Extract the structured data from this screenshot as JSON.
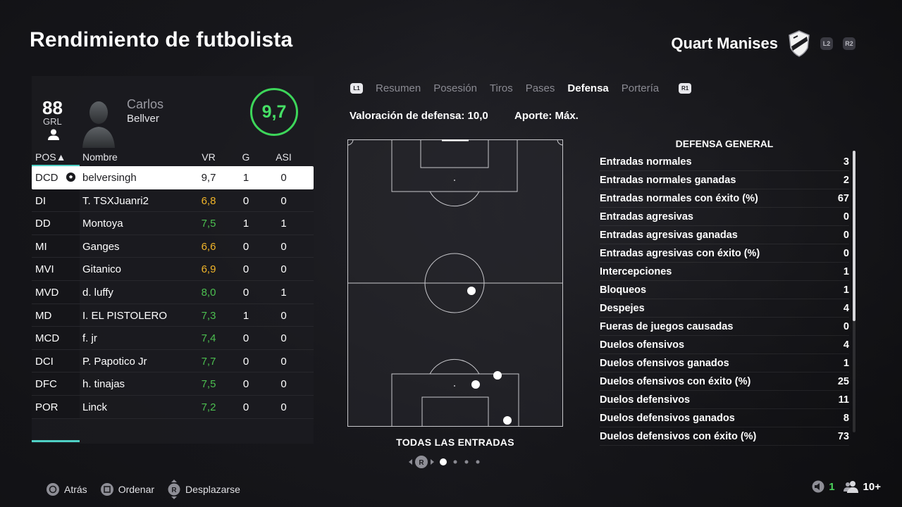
{
  "header": {
    "title": "Rendimiento de futbolista",
    "club_name": "Quart Manises",
    "l2_label": "L2",
    "r2_label": "R2"
  },
  "player": {
    "overall": "88",
    "overall_label": "GRL",
    "first_name": "Carlos",
    "last_name": "Bellver",
    "match_rating": "9,7"
  },
  "table": {
    "headers": {
      "pos": "POS▲",
      "name": "Nombre",
      "vr": "VR",
      "g": "G",
      "asi": "ASI"
    },
    "rows": [
      {
        "pos": "DCD",
        "name": "belversingh",
        "vr": "9,7",
        "g": "1",
        "asi": "0",
        "vr_tone": "dark"
      },
      {
        "pos": "DI",
        "name": "T. TSXJuanri2",
        "vr": "6,8",
        "g": "0",
        "asi": "0",
        "vr_tone": "orange"
      },
      {
        "pos": "DD",
        "name": "Montoya",
        "vr": "7,5",
        "g": "1",
        "asi": "1",
        "vr_tone": "green"
      },
      {
        "pos": "MI",
        "name": "Ganges",
        "vr": "6,6",
        "g": "0",
        "asi": "0",
        "vr_tone": "orange"
      },
      {
        "pos": "MVI",
        "name": "Gitanico",
        "vr": "6,9",
        "g": "0",
        "asi": "0",
        "vr_tone": "orange"
      },
      {
        "pos": "MVD",
        "name": "d. luffy",
        "vr": "8,0",
        "g": "0",
        "asi": "1",
        "vr_tone": "green"
      },
      {
        "pos": "MD",
        "name": "I. EL PISTOLERO",
        "vr": "7,3",
        "g": "1",
        "asi": "0",
        "vr_tone": "green"
      },
      {
        "pos": "MCD",
        "name": "f. jr",
        "vr": "7,4",
        "g": "0",
        "asi": "0",
        "vr_tone": "green"
      },
      {
        "pos": "DCI",
        "name": "P. Papotico Jr",
        "vr": "7,7",
        "g": "0",
        "asi": "0",
        "vr_tone": "green"
      },
      {
        "pos": "DFC",
        "name": "h. tinajas",
        "vr": "7,5",
        "g": "0",
        "asi": "0",
        "vr_tone": "green"
      },
      {
        "pos": "POR",
        "name": "Linck",
        "vr": "7,2",
        "g": "0",
        "asi": "0",
        "vr_tone": "green"
      }
    ]
  },
  "tabs": {
    "l1": "L1",
    "r1": "R1",
    "items": [
      {
        "label": "Resumen",
        "active": false
      },
      {
        "label": "Posesión",
        "active": false
      },
      {
        "label": "Tiros",
        "active": false
      },
      {
        "label": "Pases",
        "active": false
      },
      {
        "label": "Defensa",
        "active": true
      },
      {
        "label": "Portería",
        "active": false
      }
    ]
  },
  "defense": {
    "rating_text": "Valoración de defensa: 10,0",
    "contribution_text": "Aporte: Máx.",
    "pitch_caption": "TODAS LAS ENTRADAS",
    "stats_title": "DEFENSA GENERAL",
    "stats": [
      {
        "label": "Entradas normales",
        "value": "3"
      },
      {
        "label": "Entradas normales ganadas",
        "value": "2"
      },
      {
        "label": "Entradas normales con éxito (%)",
        "value": "67"
      },
      {
        "label": "Entradas agresivas",
        "value": "0"
      },
      {
        "label": "Entradas agresivas ganadas",
        "value": "0"
      },
      {
        "label": "Entradas agresivas con éxito (%)",
        "value": "0"
      },
      {
        "label": "Intercepciones",
        "value": "1"
      },
      {
        "label": "Bloqueos",
        "value": "1"
      },
      {
        "label": "Despejes",
        "value": "4"
      },
      {
        "label": "Fueras de juegos causadas",
        "value": "0"
      },
      {
        "label": "Duelos ofensivos",
        "value": "4"
      },
      {
        "label": "Duelos ofensivos ganados",
        "value": "1"
      },
      {
        "label": "Duelos ofensivos con éxito (%)",
        "value": "25"
      },
      {
        "label": "Duelos defensivos",
        "value": "11"
      },
      {
        "label": "Duelos defensivos ganados",
        "value": "8"
      },
      {
        "label": "Duelos defensivos con éxito (%)",
        "value": "73"
      }
    ]
  },
  "pager": {
    "r_label": "R",
    "pages": 4,
    "current": 1
  },
  "footer": {
    "back_label": "Atrás",
    "sort_label": "Ordenar",
    "scroll_label": "Desplazarse",
    "r_label": "R",
    "count_value": "1",
    "players_count": "10+"
  },
  "colors": {
    "accent": "#4fd1c5",
    "rating_green": "#46e066",
    "value_orange": "#f0b429",
    "value_green": "#4cbf50"
  }
}
